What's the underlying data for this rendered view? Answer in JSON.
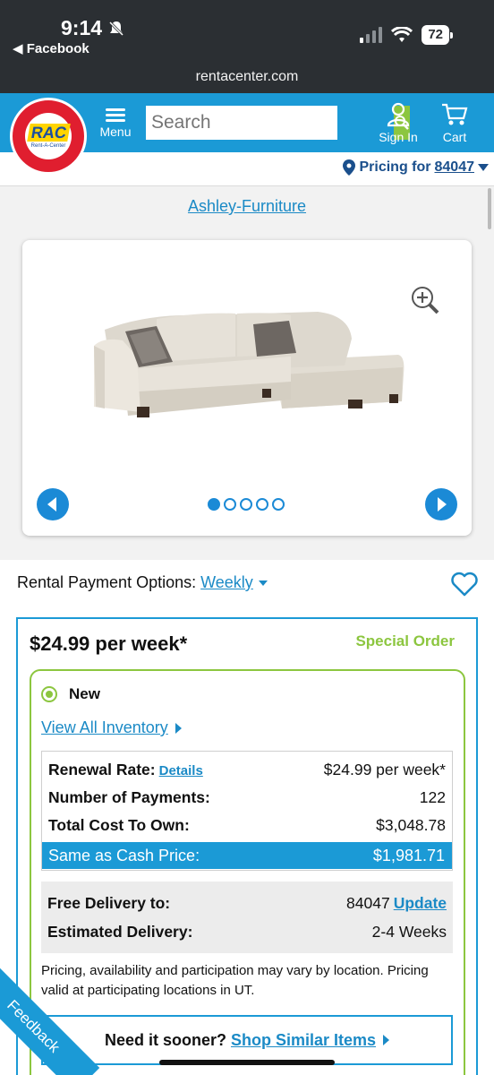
{
  "status_bar": {
    "time": "9:14",
    "back_label": "◀ Facebook",
    "battery": "72",
    "url": "rentacenter.com"
  },
  "header": {
    "logo_text": "RAC",
    "logo_sub": "Rent-A-Center",
    "menu_label": "Menu",
    "search_placeholder": "Search",
    "signin_label": "Sign In",
    "cart_label": "Cart",
    "pricing_label": "Pricing for",
    "zip": "84047"
  },
  "product": {
    "brand": "Ashley-Furniture",
    "image_count": 5,
    "active_image": 1
  },
  "rental": {
    "options_label": "Rental Payment Options:",
    "frequency": "Weekly",
    "price": "$24.99 per week*",
    "badge": "Special Order",
    "condition": "New",
    "view_all": "View All Inventory",
    "renewal_label": "Renewal Rate:",
    "details_link": "Details",
    "renewal_value": "$24.99 per week*",
    "payments_label": "Number of Payments:",
    "payments_value": "122",
    "total_label": "Total Cost To Own:",
    "total_value": "$3,048.78",
    "cash_label": "Same as Cash Price:",
    "cash_value": "$1,981.71",
    "delivery_label": "Free Delivery to:",
    "delivery_zip": "84047",
    "update_link": "Update",
    "est_label": "Estimated Delivery:",
    "est_value": "2-4 Weeks",
    "disclaimer": "Pricing, availability and participation may vary by location. Pricing valid at participating locations in UT.",
    "sooner_label": "Need it sooner?",
    "sooner_link": "Shop Similar Items"
  },
  "feedback_label": "Feedback",
  "colors": {
    "brand_blue": "#1b9ad6",
    "accent_green": "#8cc63f",
    "logo_red": "#e01e2f"
  }
}
